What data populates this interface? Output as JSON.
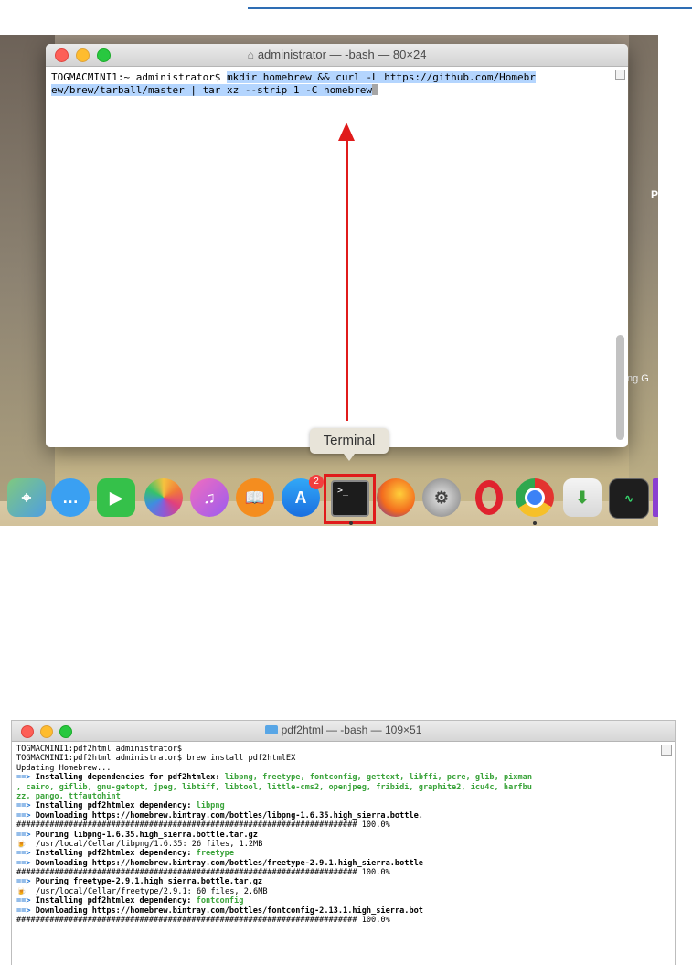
{
  "screenshot1": {
    "window_title": "administrator — -bash — 80×24",
    "prompt": "TOGMACMINI1:~ administrator$ ",
    "command_line1": "mkdir homebrew && curl -L https://github.com/Homebr",
    "command_line2": "ew/brew/tarball/master | tar xz --strip 1 -C homebrew",
    "tooltip": "Terminal",
    "badge_count": "2",
    "desktop_glyph_p": "P",
    "desktop_glyph_ng": "ng  G",
    "dock_icons": [
      "maps-icon",
      "messages-icon",
      "facetime-icon",
      "photos-icon",
      "itunes-icon",
      "ibooks-icon",
      "app-store-icon",
      "terminal-icon",
      "firefox-icon",
      "system-preferences-icon",
      "opera-icon",
      "chrome-icon",
      "installer-icon",
      "activity-monitor-icon"
    ],
    "colors": {
      "arrow": "#e01b1b",
      "selection": "#b4d5fe"
    }
  },
  "screenshot2": {
    "window_title": "pdf2html — -bash — 109×51",
    "lines": {
      "l1": "TOGMACMINI1:pdf2html administrator$",
      "l2": "TOGMACMINI1:pdf2html administrator$ brew install pdf2htmlEX",
      "l3": "Updating Homebrew...",
      "l4_label": "Installing dependencies for pdf2htmlex: ",
      "l4_deps": "libpng, freetype, fontconfig, gettext, libffi, pcre, glib, pixman",
      "l5": ", cairo, giflib, gnu-getopt, jpeg, libtiff, libtool, little-cms2, openjpeg, fribidi, graphite2, icu4c, harfbu",
      "l6": "zz, pango, ttfautohint",
      "l7_label": "Installing pdf2htmlex dependency: ",
      "l7_dep": "libpng",
      "l8": "Downloading https://homebrew.bintray.com/bottles/libpng-1.6.35.high_sierra.bottle.",
      "l9": "######################################################################## 100.0%",
      "l10": "Pouring libpng-1.6.35.high_sierra.bottle.tar.gz",
      "l11": "/usr/local/Cellar/libpng/1.6.35: 26 files, 1.2MB",
      "l12_label": "Installing pdf2htmlex dependency: ",
      "l12_dep": "freetype",
      "l13": "Downloading https://homebrew.bintray.com/bottles/freetype-2.9.1.high_sierra.bottle",
      "l14": "######################################################################## 100.0%",
      "l15": "Pouring freetype-2.9.1.high_sierra.bottle.tar.gz",
      "l16": "/usr/local/Cellar/freetype/2.9.1: 60 files, 2.6MB",
      "l17_label": "Installing pdf2htmlex dependency: ",
      "l17_dep": "fontconfig",
      "l18": "Downloading https://homebrew.bintray.com/bottles/fontconfig-2.13.1.high_sierra.bot",
      "l19": "######################################################################## 100.0%"
    },
    "arrow_glyph": "==>",
    "beer_glyph": "🍺",
    "colors": {
      "arrow": "#2a7bd5",
      "dependency": "#3aa33a"
    }
  }
}
